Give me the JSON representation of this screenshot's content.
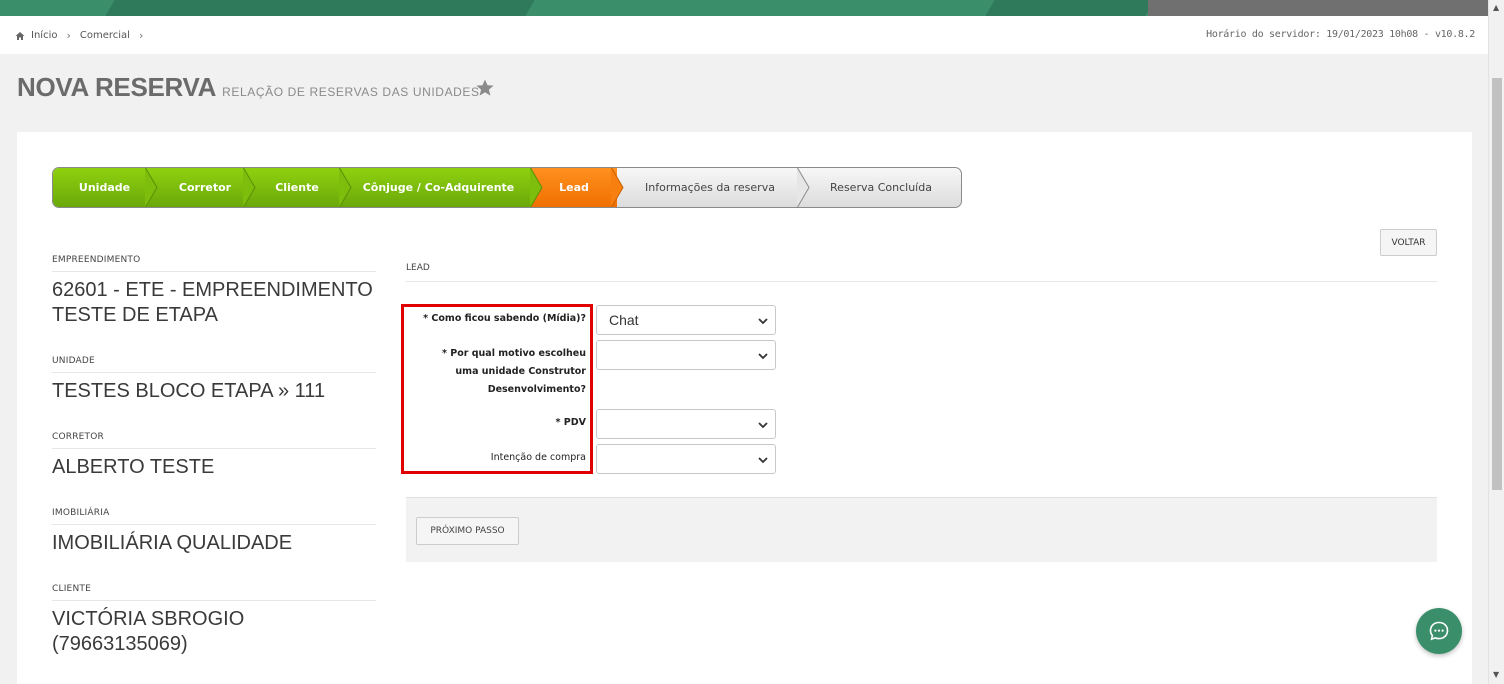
{
  "breadcrumb": {
    "home": "Início",
    "section": "Comercial"
  },
  "server_time": "Horário do servidor: 19/01/2023 10h08 - v10.8.2",
  "page": {
    "title": "NOVA RESERVA",
    "subtitle": "RELAÇÃO DE RESERVAS DAS UNIDADES"
  },
  "steps": [
    {
      "label": "Unidade",
      "state": "done"
    },
    {
      "label": "Corretor",
      "state": "done"
    },
    {
      "label": "Cliente",
      "state": "done"
    },
    {
      "label": "Cônjuge / Co-Adquirente",
      "state": "done"
    },
    {
      "label": "Lead",
      "state": "active"
    },
    {
      "label": "Informações da reserva",
      "state": "todo"
    },
    {
      "label": "Reserva Concluída",
      "state": "todo"
    }
  ],
  "info": {
    "empreendimento_label": "EMPREENDIMENTO",
    "empreendimento_line1": "62601 - ETE - EMPREENDIMENTO",
    "empreendimento_line2": "TESTE DE ETAPA",
    "unidade_label": "UNIDADE",
    "unidade_value": "TESTES BLOCO ETAPA » 111",
    "corretor_label": "CORRETOR",
    "corretor_value": "ALBERTO TESTE",
    "imobiliaria_label": "IMOBILIÁRIA",
    "imobiliaria_value": "IMOBILIÁRIA QUALIDADE",
    "cliente_label": "CLIENTE",
    "cliente_line1": "VICTÓRIA SBROGIO",
    "cliente_line2": "(79663135069)"
  },
  "form": {
    "section_label": "LEAD",
    "back_label": "VOLTAR",
    "midia_label": "* Como ficou sabendo (Mídia)?",
    "midia_value": "Chat",
    "motivo_label_1": "* Por qual motivo escolheu",
    "motivo_label_2": "uma unidade Construtor",
    "motivo_label_3": "Desenvolvimento?",
    "motivo_value": "",
    "pdv_label": "* PDV",
    "pdv_value": "",
    "intencao_label": "Intenção de compra",
    "intencao_value": "",
    "next_label": "PRÓXIMO PASSO"
  },
  "colors": {
    "brand_green": "#3a8f6a",
    "step_done": "#7dbd0c",
    "step_active": "#f77f10",
    "highlight_red": "#e00000"
  }
}
